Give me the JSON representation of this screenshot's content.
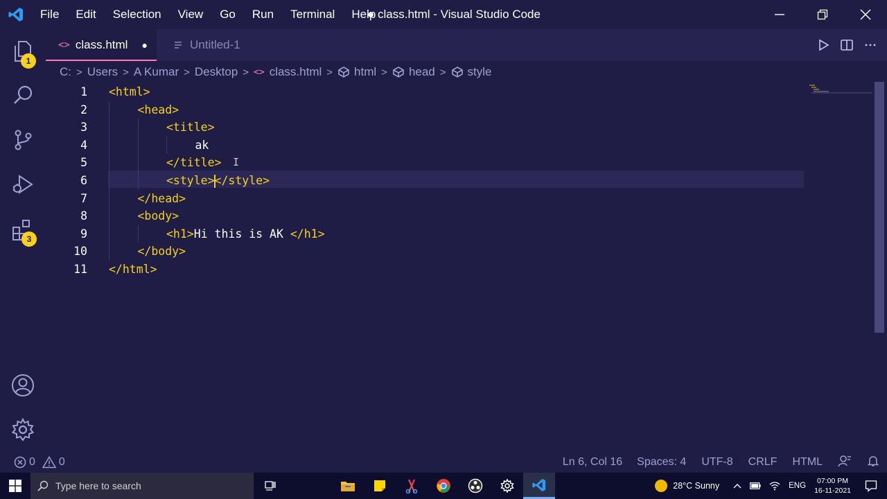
{
  "window": {
    "title": "● class.html - Visual Studio Code",
    "menu": [
      "File",
      "Edit",
      "Selection",
      "View",
      "Go",
      "Run",
      "Terminal",
      "Help"
    ]
  },
  "activity": {
    "explorer_badge": "1",
    "extensions_badge": "3"
  },
  "tabs": [
    {
      "label": "class.html",
      "dirty_marker": "●",
      "active": true
    },
    {
      "label": "Untitled-1",
      "active": false
    }
  ],
  "breadcrumb": [
    "C:",
    "Users",
    "A Kumar",
    "Desktop",
    "class.html",
    "html",
    "head",
    "style"
  ],
  "editor": {
    "line_numbers": [
      "1",
      "2",
      "3",
      "4",
      "5",
      "6",
      "7",
      "8",
      "9",
      "10",
      "11"
    ],
    "lines": [
      {
        "indent": 0,
        "parts": [
          {
            "t": "tag",
            "v": "<html>"
          }
        ]
      },
      {
        "indent": 1,
        "parts": [
          {
            "t": "tag",
            "v": "<head>"
          }
        ]
      },
      {
        "indent": 2,
        "parts": [
          {
            "t": "tag",
            "v": "<title>"
          }
        ]
      },
      {
        "indent": 3,
        "parts": [
          {
            "t": "plain",
            "v": "ak"
          }
        ]
      },
      {
        "indent": 2,
        "parts": [
          {
            "t": "tag",
            "v": "</title>"
          }
        ]
      },
      {
        "indent": 2,
        "parts": [
          {
            "t": "tag",
            "v": "<style>"
          },
          {
            "t": "cursor",
            "v": ""
          },
          {
            "t": "tag",
            "v": "</style>"
          }
        ]
      },
      {
        "indent": 1,
        "parts": [
          {
            "t": "tag",
            "v": "</head>"
          }
        ]
      },
      {
        "indent": 1,
        "parts": [
          {
            "t": "tag",
            "v": "<body>"
          }
        ]
      },
      {
        "indent": 2,
        "parts": [
          {
            "t": "tag",
            "v": "<h1>"
          },
          {
            "t": "plain",
            "v": "Hi this is AK "
          },
          {
            "t": "tag",
            "v": "</h1>"
          }
        ]
      },
      {
        "indent": 1,
        "parts": [
          {
            "t": "tag",
            "v": "</body>"
          }
        ]
      },
      {
        "indent": 0,
        "parts": [
          {
            "t": "tag",
            "v": "</html>"
          }
        ]
      }
    ]
  },
  "status": {
    "errors": "0",
    "warnings": "0",
    "position": "Ln 6, Col 16",
    "spaces": "Spaces: 4",
    "encoding": "UTF-8",
    "eol": "CRLF",
    "language": "HTML"
  },
  "taskbar": {
    "search_placeholder": "Type here to search",
    "weather": "28°C  Sunny",
    "language": "ENG",
    "time": "07:00 PM",
    "date": "16-11-2021"
  },
  "colors": {
    "background": "#1f1d45",
    "tag": "#f7d11d",
    "accent": "#ff7ab2",
    "muted": "#a19fd0"
  }
}
